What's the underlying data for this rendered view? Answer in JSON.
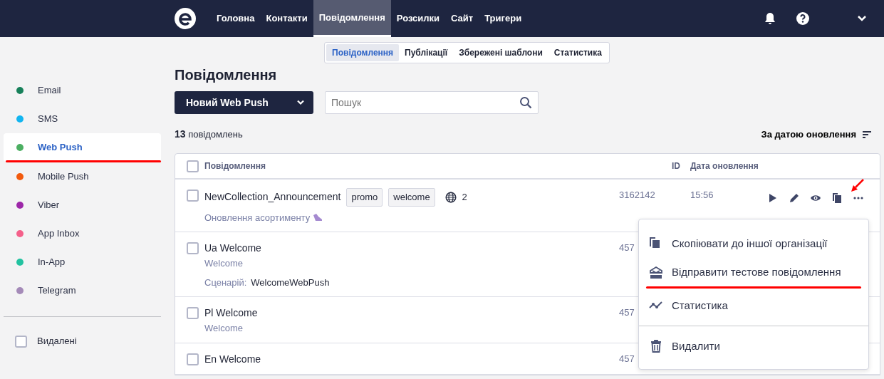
{
  "top_nav": {
    "items": [
      {
        "label": "Головна",
        "selected": false
      },
      {
        "label": "Контакти",
        "selected": false
      },
      {
        "label": "Повідомлення",
        "selected": true
      },
      {
        "label": "Розсилки",
        "selected": false
      },
      {
        "label": "Сайт",
        "selected": false
      },
      {
        "label": "Тригери",
        "selected": false
      }
    ]
  },
  "sub_nav": {
    "items": [
      {
        "label": "Повідомлення",
        "selected": true
      },
      {
        "label": "Публікації",
        "selected": false
      },
      {
        "label": "Збережені шаблони",
        "selected": false
      },
      {
        "label": "Статистика",
        "selected": false
      }
    ]
  },
  "sidebar": {
    "items": [
      {
        "label": "Email",
        "color": "#17805a",
        "selected": false
      },
      {
        "label": "SMS",
        "color": "#12b5f0",
        "selected": false
      },
      {
        "label": "Web Push",
        "color": "#4caf62",
        "selected": true
      },
      {
        "label": "Mobile Push",
        "color": "#f25a0d",
        "selected": false
      },
      {
        "label": "Viber",
        "color": "#9c27a8",
        "selected": false
      },
      {
        "label": "App Inbox",
        "color": "#f4608a",
        "selected": false
      },
      {
        "label": "In-App",
        "color": "#22c2a0",
        "selected": false
      },
      {
        "label": "Telegram",
        "color": "#a48ab8",
        "selected": false
      }
    ],
    "deleted": {
      "label": "Видалені",
      "checked": false
    }
  },
  "page": {
    "title": "Повідомлення",
    "new_button": "Новий Web Push",
    "search": {
      "placeholder": "Пошук"
    },
    "count": "13",
    "count_label": "повідомлень",
    "sort": "За датою оновлення"
  },
  "table": {
    "columns": [
      "Повідомлення",
      "ID",
      "Дата оновлення"
    ],
    "select_all_checked": false,
    "rows": [
      {
        "name": "NewCollection_Announcement",
        "tags": [
          "promo",
          "welcome"
        ],
        "sites": "2",
        "subtitle": "Оновлення асортименту",
        "id": "3162142",
        "date": "15:56",
        "checked": false,
        "actions": true
      },
      {
        "name": "Ua Welcome",
        "subtitle": "Welcome",
        "scenario_label": "Сценарій:",
        "scenario": "WelcomeWebPush",
        "id": "457",
        "checked": false,
        "actions": false
      },
      {
        "name": "Pl Welcome",
        "subtitle": "Welcome",
        "id": "457",
        "checked": false,
        "actions": false
      },
      {
        "name": "En Welcome",
        "id": "457",
        "checked": false,
        "actions": false
      }
    ]
  },
  "context_menu": {
    "items": [
      {
        "label": "Скопіювати до іншої організації",
        "kind": "copy"
      },
      {
        "label": "Відправити тестове повідомлення",
        "kind": "test"
      },
      {
        "label": "Статистика",
        "kind": "stats"
      },
      {
        "label": "Видалити",
        "kind": "delete"
      }
    ]
  }
}
